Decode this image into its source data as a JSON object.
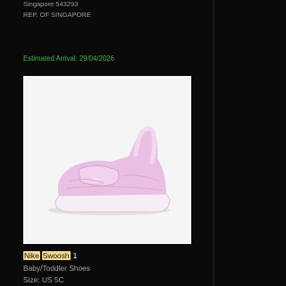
{
  "shipping": {
    "address_line_1": "Singapore 543293",
    "address_line_2": "REP. OF SINGAPORE",
    "estimated_arrival": "Estimated Arrival: 29/04/2026"
  },
  "product": {
    "image_icon": "baby-shoe-image",
    "title_word_1": "Nike",
    "title_word_2": "Swoosh",
    "title_suffix": "1",
    "category": "Baby/Toddler Shoes",
    "size": "Size: US 5C"
  },
  "colors": {
    "background": "#0a0a0a",
    "accent_green": "#47b34a",
    "highlight": "#f2d98a",
    "shoe_pink": "#e9bfe4"
  }
}
